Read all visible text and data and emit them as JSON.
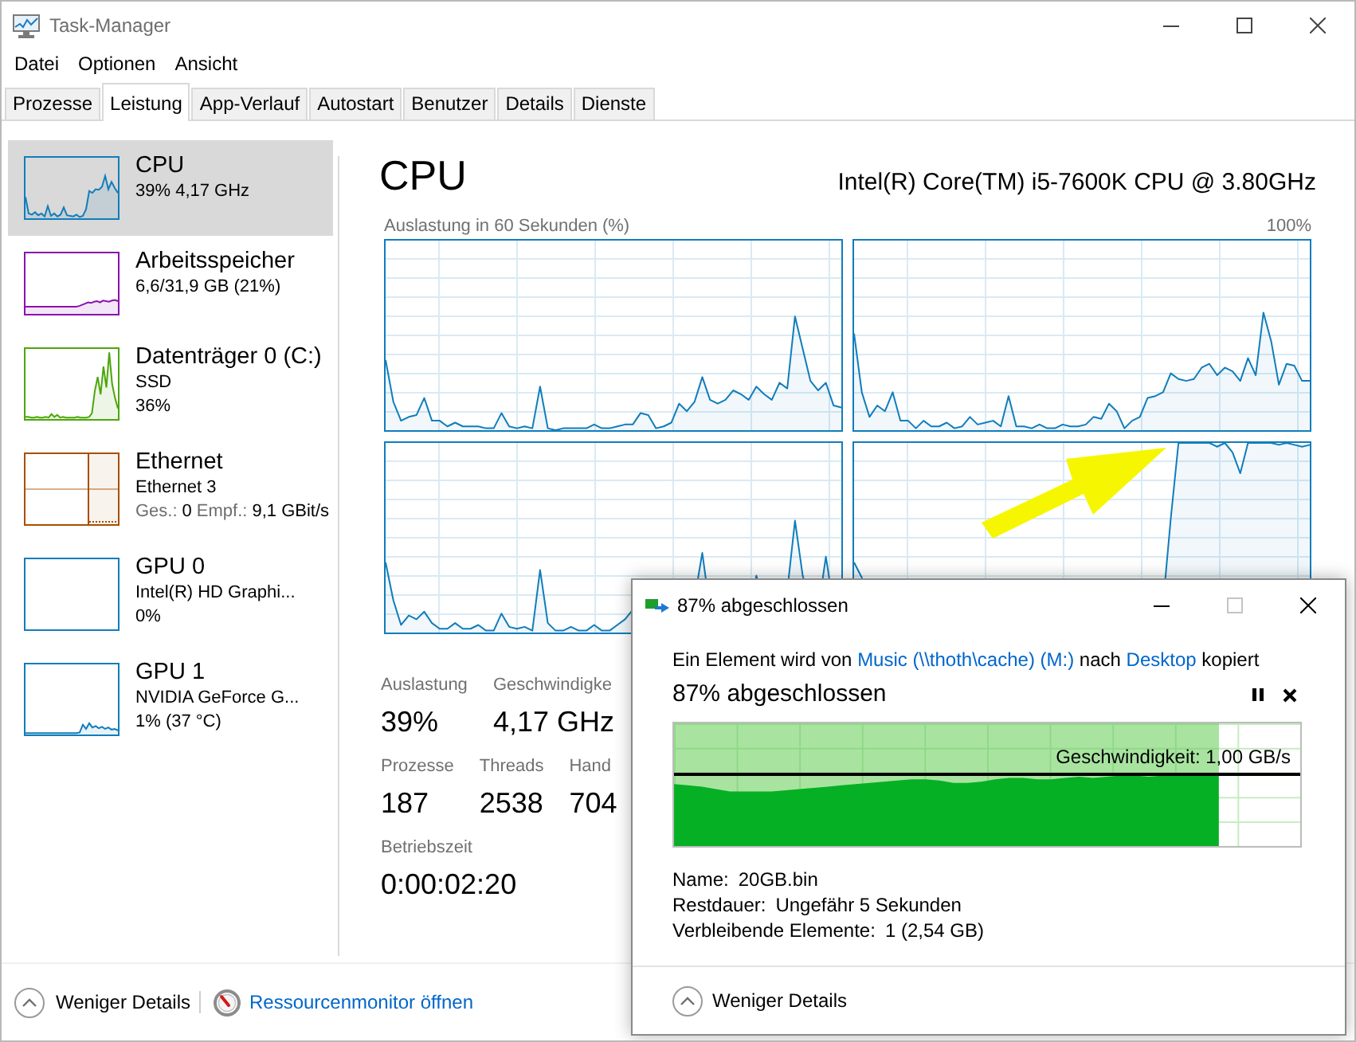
{
  "window": {
    "title": "Task-Manager"
  },
  "menu": [
    "Datei",
    "Optionen",
    "Ansicht"
  ],
  "tabs": [
    {
      "label": "Prozesse",
      "selected": false
    },
    {
      "label": "Leistung",
      "selected": true
    },
    {
      "label": "App-Verlauf",
      "selected": false
    },
    {
      "label": "Autostart",
      "selected": false
    },
    {
      "label": "Benutzer",
      "selected": false
    },
    {
      "label": "Details",
      "selected": false
    },
    {
      "label": "Dienste",
      "selected": false
    }
  ],
  "sidebar": {
    "items": [
      {
        "kind": "cpu",
        "title": "CPU",
        "lines": [
          "39% 4,17 GHz"
        ],
        "color": "#117dbb",
        "selected": true
      },
      {
        "kind": "memory",
        "title": "Arbeitsspeicher",
        "lines": [
          "6,6/31,9 GB (21%)"
        ],
        "color": "#8b12ae",
        "selected": false
      },
      {
        "kind": "disk",
        "title": "Datenträger 0 (C:)",
        "lines": [
          "SSD",
          "36%"
        ],
        "color": "#4da60c",
        "selected": false
      },
      {
        "kind": "network",
        "title": "Ethernet",
        "lines": [
          "Ethernet 3"
        ],
        "rates": [
          {
            "label": "Ges.:",
            "value": "0"
          },
          {
            "label": "Empf.:",
            "value": "9,1 GBit/s"
          }
        ],
        "color": "#a74f01",
        "selected": false
      },
      {
        "kind": "gpu",
        "title": "GPU 0",
        "lines": [
          "Intel(R) HD Graphi...",
          "0%"
        ],
        "color": "#117dbb",
        "selected": false
      },
      {
        "kind": "gpu",
        "title": "GPU 1",
        "lines": [
          "NVIDIA GeForce G...",
          "1% (37 °C)"
        ],
        "color": "#117dbb",
        "selected": false
      }
    ]
  },
  "cpu": {
    "title": "CPU",
    "model": "Intel(R) Core(TM) i5-7600K CPU @ 3.80GHz",
    "graph_caption": "Auslastung in 60 Sekunden (%)",
    "graph_max": "100%",
    "stat_rows": [
      [
        {
          "label": "Auslastung",
          "value": "39%"
        },
        {
          "label": "Geschwindigke",
          "value": "4,17 GHz"
        }
      ],
      [
        {
          "label": "Prozesse",
          "value": "187"
        },
        {
          "label": "Threads",
          "value": "2538"
        },
        {
          "label": "Hand",
          "value": "704"
        }
      ],
      [
        {
          "label": "Betriebszeit",
          "value": "0:00:02:20"
        }
      ]
    ]
  },
  "footer": {
    "toggle": "Weniger Details",
    "link": "Ressourcenmonitor öffnen"
  },
  "copy_dialog": {
    "title": "87% abgeschlossen",
    "maximize": {
      "disabled": true
    },
    "message": [
      {
        "kind": "text",
        "text": "Ein Element wird von "
      },
      {
        "kind": "link",
        "text": "Music (\\\\thoth\\cache) (M:)"
      },
      {
        "kind": "text",
        "text": " nach "
      },
      {
        "kind": "link",
        "text": "Desktop"
      },
      {
        "kind": "text",
        "text": " kopiert"
      }
    ],
    "status": "87% abgeschlossen",
    "progress": {
      "level": 0.87,
      "speed": "Geschwindigkeit: 1,00 GB/s"
    },
    "details": [
      {
        "label": "Name:",
        "value": "20GB.bin"
      },
      {
        "label": "Restdauer:",
        "value": "Ungefähr 5 Sekunden"
      },
      {
        "label": "Verbleibende Elemente:",
        "value": "1 (2,54 GB)"
      }
    ],
    "toggle": "Weniger Details"
  }
}
